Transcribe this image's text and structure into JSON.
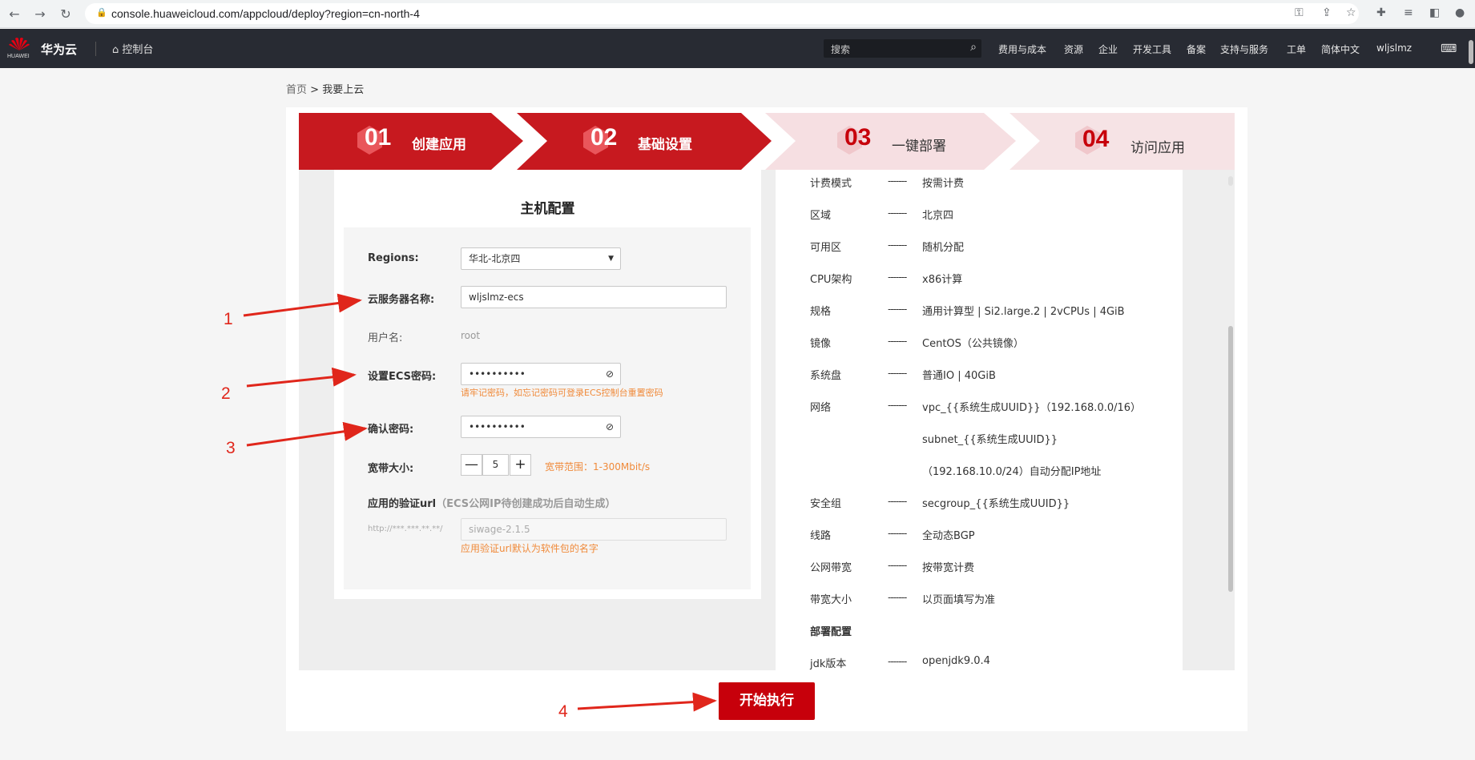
{
  "browser": {
    "url": "console.huaweicloud.com/appcloud/deploy?region=cn-north-4"
  },
  "topnav": {
    "logo_sub": "HUAWEI",
    "brand": "华为云",
    "console": "控制台",
    "search_placeholder": "搜索",
    "links": [
      "费用与成本",
      "资源",
      "企业",
      "开发工具",
      "备案",
      "支持与服务",
      "工单",
      "简体中文",
      "wljslmz"
    ]
  },
  "breadcrumb": {
    "home": "首页",
    "sep": ">",
    "current": "我要上云"
  },
  "steps": [
    {
      "num": "01",
      "label": "创建应用"
    },
    {
      "num": "02",
      "label": "基础设置"
    },
    {
      "num": "03",
      "label": "一键部署"
    },
    {
      "num": "04",
      "label": "访问应用"
    }
  ],
  "form": {
    "title": "主机配置",
    "regions_label": "Regions:",
    "regions_value": "华北-北京四",
    "server_name_label": "云服务器名称:",
    "server_name_value": "wljslmz-ecs",
    "username_label": "用户名:",
    "username_value": "root",
    "password_label": "设置ECS密码:",
    "password_value": "••••••••••",
    "password_hint": "请牢记密码，如忘记密码可登录ECS控制台重置密码",
    "confirm_label": "确认密码:",
    "confirm_value": "••••••••••",
    "bandwidth_label": "宽带大小:",
    "bandwidth_value": "5",
    "bandwidth_minus": "—",
    "bandwidth_plus": "+",
    "bandwidth_hint": "宽带范围：1-300Mbit/s",
    "url_label": "应用的验证url",
    "url_note": "（ECS公网IP待创建成功后自动生成）",
    "url_prefix": "http://***.***.**.**/",
    "url_value": "siwage-2.1.5",
    "url_hint": "应用验证url默认为软件包的名字"
  },
  "summary": {
    "dash": "-------",
    "rows": [
      {
        "label": "计费模式",
        "value": "按需计费"
      },
      {
        "label": "区域",
        "value": "北京四"
      },
      {
        "label": "可用区",
        "value": "随机分配"
      },
      {
        "label": "CPU架构",
        "value": "x86计算"
      },
      {
        "label": "规格",
        "value": "通用计算型 | Si2.large.2 | 2vCPUs | 4GiB"
      },
      {
        "label": "镜像",
        "value": "CentOS（公共镜像）"
      },
      {
        "label": "系统盘",
        "value": "普通IO | 40GiB"
      },
      {
        "label": "网络",
        "value": "vpc_{{系统生成UUID}}（192.168.0.0/16）"
      }
    ],
    "network_line2": "subnet_{{系统生成UUID}}",
    "network_line3": "（192.168.10.0/24）自动分配IP地址",
    "rows2": [
      {
        "label": "安全组",
        "value": "secgroup_{{系统生成UUID}}"
      },
      {
        "label": "线路",
        "value": "全动态BGP"
      },
      {
        "label": "公网带宽",
        "value": "按带宽计费"
      },
      {
        "label": "带宽大小",
        "value": "以页面填写为准"
      }
    ],
    "deploy_heading": "部署配置",
    "jdk_label": "jdk版本",
    "jdk_value": "openjdk9.0.4"
  },
  "run_button": "开始执行",
  "annotations": [
    "1",
    "2",
    "3",
    "4"
  ],
  "colors": {
    "brand_red": "#c7000b",
    "step_active": "#c7191f",
    "step_inactive": "#f7e3e5",
    "hint_orange": "#f08a3a",
    "annotation_red": "#e0261b"
  }
}
